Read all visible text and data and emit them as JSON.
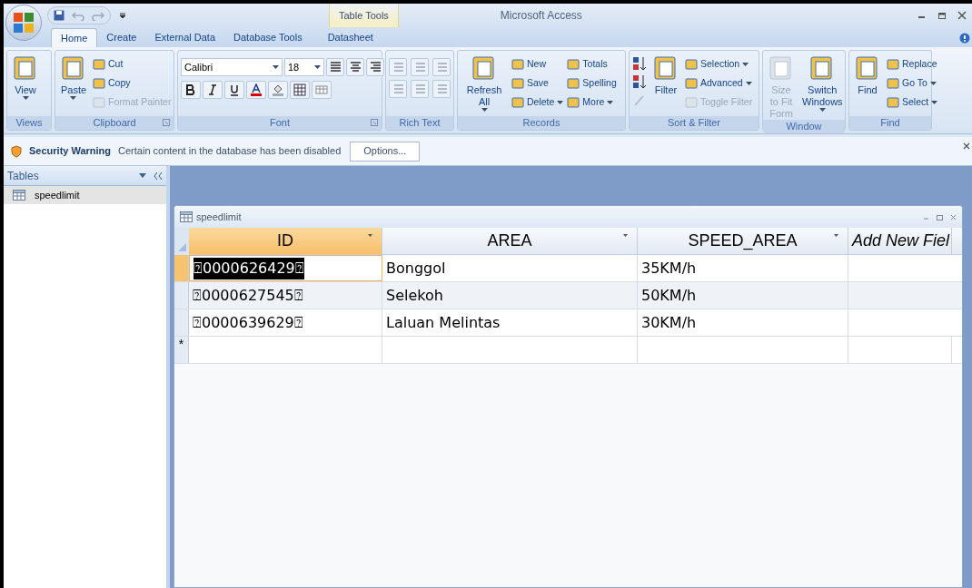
{
  "window": {
    "title": "Microsoft Access",
    "context_group": "Table Tools"
  },
  "tabs": [
    {
      "label": "Home",
      "selected": true,
      "kind": "main"
    },
    {
      "label": "Create",
      "selected": false,
      "kind": "main"
    },
    {
      "label": "External Data",
      "selected": false,
      "kind": "main"
    },
    {
      "label": "Database Tools",
      "selected": false,
      "kind": "main"
    },
    {
      "label": "Datasheet",
      "selected": false,
      "kind": "context"
    }
  ],
  "ribbon_groups": [
    {
      "label": "Views",
      "kind": "views",
      "items": [
        {
          "label": "View",
          "kind": "large",
          "disabled": false,
          "dropdown": true
        }
      ]
    },
    {
      "label": "Clipboard",
      "kind": "basic",
      "items": [
        {
          "label": "Paste",
          "kind": "large",
          "disabled": false,
          "dropdown": true
        },
        {
          "label": "Cut",
          "kind": "small",
          "disabled": false,
          "dropdown": false
        },
        {
          "label": "Copy",
          "kind": "small",
          "disabled": false,
          "dropdown": false
        },
        {
          "label": "Format Painter",
          "kind": "small",
          "disabled": true,
          "dropdown": false
        }
      ]
    },
    {
      "label": "Font",
      "kind": "font",
      "font_name": "Calibri",
      "font_size": "18"
    },
    {
      "label": "Rich Text",
      "kind": "richtext"
    },
    {
      "label": "Records",
      "kind": "basic",
      "items": [
        {
          "label": "Refresh All",
          "kind": "large",
          "disabled": false,
          "dropdown": true
        },
        {
          "label": "New",
          "kind": "small",
          "disabled": false,
          "dropdown": false
        },
        {
          "label": "Save",
          "kind": "small",
          "disabled": false,
          "dropdown": false
        },
        {
          "label": "Delete",
          "kind": "small",
          "disabled": false,
          "dropdown": true
        },
        {
          "label": "Totals",
          "kind": "small",
          "disabled": false,
          "dropdown": false
        },
        {
          "label": "Spelling",
          "kind": "small",
          "disabled": false,
          "dropdown": false
        },
        {
          "label": "More",
          "kind": "small",
          "disabled": false,
          "dropdown": true
        }
      ]
    },
    {
      "label": "Sort & Filter",
      "kind": "sort",
      "items": [
        {
          "label": "Filter",
          "kind": "large",
          "disabled": false,
          "dropdown": false
        },
        {
          "label": "Selection",
          "kind": "small",
          "disabled": false,
          "dropdown": true
        },
        {
          "label": "Advanced",
          "kind": "small",
          "disabled": false,
          "dropdown": true
        },
        {
          "label": "Toggle Filter",
          "kind": "small",
          "disabled": true,
          "dropdown": false
        }
      ]
    },
    {
      "label": "Window",
      "kind": "basic",
      "items": [
        {
          "label": "Size to Fit Form",
          "kind": "large",
          "disabled": true,
          "dropdown": false
        },
        {
          "label": "Switch Windows",
          "kind": "large",
          "disabled": false,
          "dropdown": true
        }
      ]
    },
    {
      "label": "Find",
      "kind": "basic",
      "items": [
        {
          "label": "Find",
          "kind": "large",
          "disabled": false,
          "dropdown": false
        },
        {
          "label": "Replace",
          "kind": "small",
          "disabled": false,
          "dropdown": false
        },
        {
          "label": "Go To",
          "kind": "small",
          "disabled": false,
          "dropdown": true
        },
        {
          "label": "Select",
          "kind": "small",
          "disabled": false,
          "dropdown": true
        }
      ]
    }
  ],
  "security_bar": {
    "title": "Security Warning",
    "message": "Certain content in the database has been disabled",
    "button": "Options..."
  },
  "nav_pane": {
    "header": "Tables",
    "items": [
      {
        "label": "speedlimit",
        "selected": true
      }
    ]
  },
  "datasheet": {
    "title": "speedlimit",
    "columns": [
      {
        "label": "ID",
        "kind": "field",
        "selected": true
      },
      {
        "label": "AREA",
        "kind": "field",
        "selected": false
      },
      {
        "label": "SPEED_AREA",
        "kind": "field",
        "selected": false
      },
      {
        "label": "Add New Fiel",
        "kind": "add",
        "selected": false
      }
    ],
    "rows": [
      {
        "selected": true,
        "cells": [
          "⍰0000626429⍰",
          "Bonggol",
          "35KM/h"
        ]
      },
      {
        "selected": false,
        "cells": [
          "⍰0000627545⍰",
          "Selekoh",
          "50KM/h"
        ]
      },
      {
        "selected": false,
        "cells": [
          "⍰0000639629⍰",
          "Laluan Melintas",
          "30KM/h"
        ]
      }
    ],
    "new_row_marker": "*"
  }
}
